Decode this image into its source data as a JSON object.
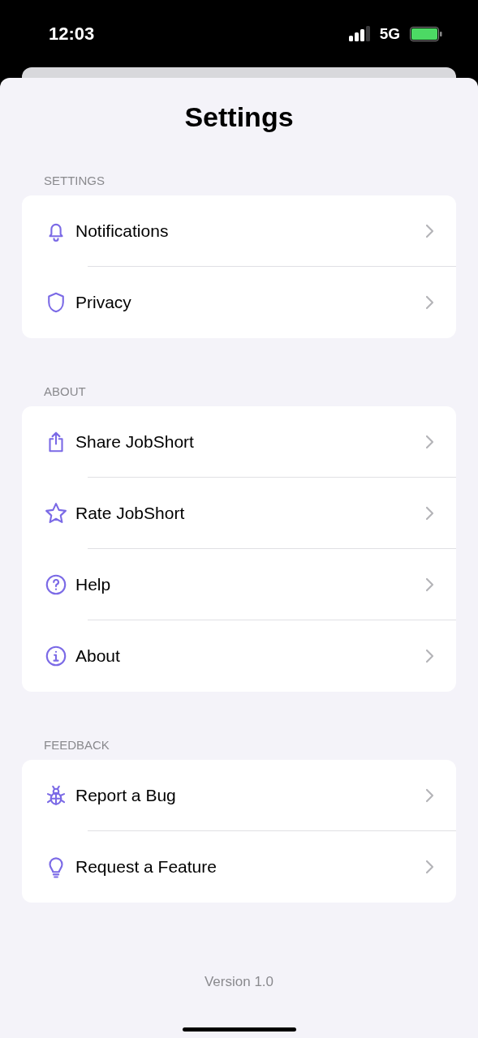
{
  "status_bar": {
    "time": "12:03",
    "network": "5G"
  },
  "title": "Settings",
  "sections": [
    {
      "header": "SETTINGS",
      "items": [
        {
          "label": "Notifications",
          "kind": "bell"
        },
        {
          "label": "Privacy",
          "kind": "shield"
        }
      ]
    },
    {
      "header": "ABOUT",
      "items": [
        {
          "label": "Share JobShort",
          "kind": "share"
        },
        {
          "label": "Rate JobShort",
          "kind": "star"
        },
        {
          "label": "Help",
          "kind": "question"
        },
        {
          "label": "About",
          "kind": "info"
        }
      ]
    },
    {
      "header": "FEEDBACK",
      "items": [
        {
          "label": "Report a Bug",
          "kind": "bug"
        },
        {
          "label": "Request a Feature",
          "kind": "bulb"
        }
      ]
    }
  ],
  "version": "Version 1.0"
}
